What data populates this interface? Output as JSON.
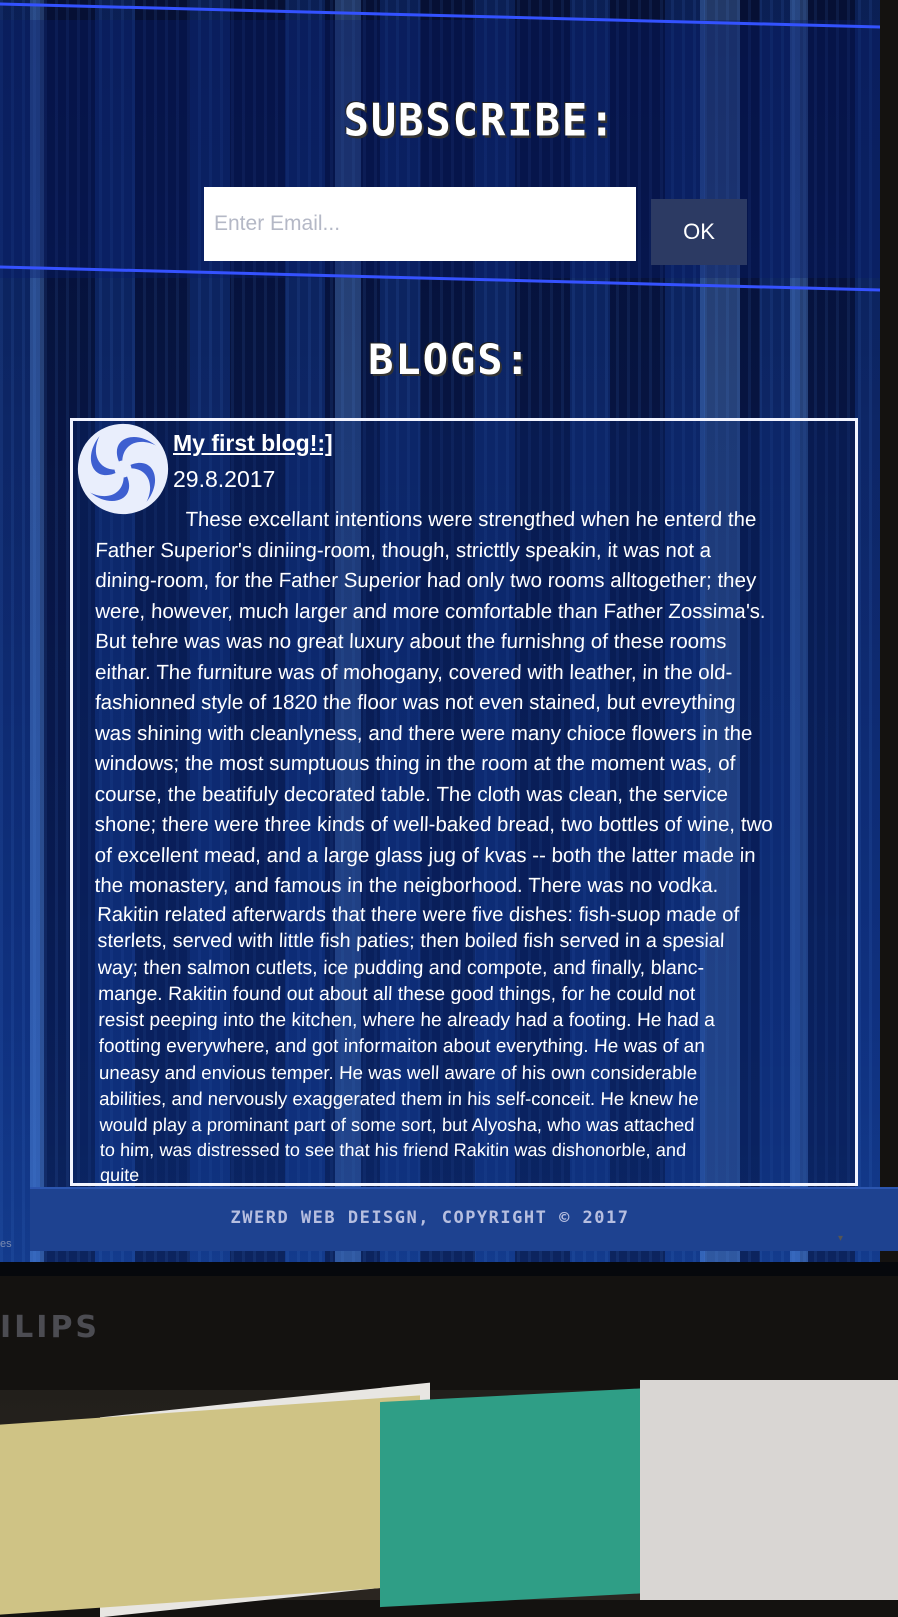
{
  "subscribe": {
    "title": "SUBSCRIBE:",
    "email_placeholder": "Enter Email...",
    "ok_label": "OK"
  },
  "blogs": {
    "title": "BLOGS:",
    "post": {
      "logo_icon": "swirl-logo-icon",
      "title": "My first blog!:]",
      "date": "29.8.2017",
      "body_lines": [
        "These excellant intentions were strengthed when he enterd the",
        "Father Superior's diniing-room, though, stricttly speakin, it was not a",
        "dining-room, for the Father Superior had only two rooms alltogether; they",
        "were, however, much larger and more comfortable than Father Zossima's.",
        "But tehre was was no great luxury about the furnishng of these rooms",
        "eithar. The furniture was of mohogany, covered with leather, in the old-",
        "fashionned style of 1820 the floor was not even stained, but evreything",
        "was shining with cleanlyness, and there were many chioce flowers in the",
        "windows; the most sumptuous thing in the room at the moment was, of",
        "course, the beatifuly decorated table. The cloth was clean, the service",
        "shone; there were three kinds of well-baked bread, two bottles of wine, two",
        "of excellent mead, and a large glass jug of kvas -- both the latter made in",
        "the monastery, and famous in the neigborhood. There was no vodka.",
        "Rakitin related afterwards that there were five dishes: fish-suop made of",
        "sterlets, served with little fish paties; then boiled fish served in a spesial",
        "way; then salmon cutlets, ice pudding and compote, and finally, blanc-",
        "mange. Rakitin found out about all these good things, for he could not",
        "resist peeping into the kitchen, where he already had a footing. He had a",
        "footting everywhere, and got informaiton about everything. He was of an",
        "uneasy and envious temper. He was well aware of his own considerable",
        "abilities, and nervously exaggerated them in his self-conceit. He knew he",
        "would play a prominant part of some sort, but Alyosha, who was attached",
        "to him, was distressed to see that his friend Rakitin was dishonorble, and",
        "quite"
      ]
    }
  },
  "footer": {
    "text": "ZWERD WEB DEISGN, COPYRIGHT © 2017"
  },
  "screen_edge": {
    "side_label": "es",
    "scroll_arrow": "▾"
  },
  "monitor": {
    "brand": "ILIPS"
  },
  "colors": {
    "accent_line": "#3352ff",
    "footer_bg": "#1e4290",
    "ok_button_bg": "#2c3a63"
  }
}
